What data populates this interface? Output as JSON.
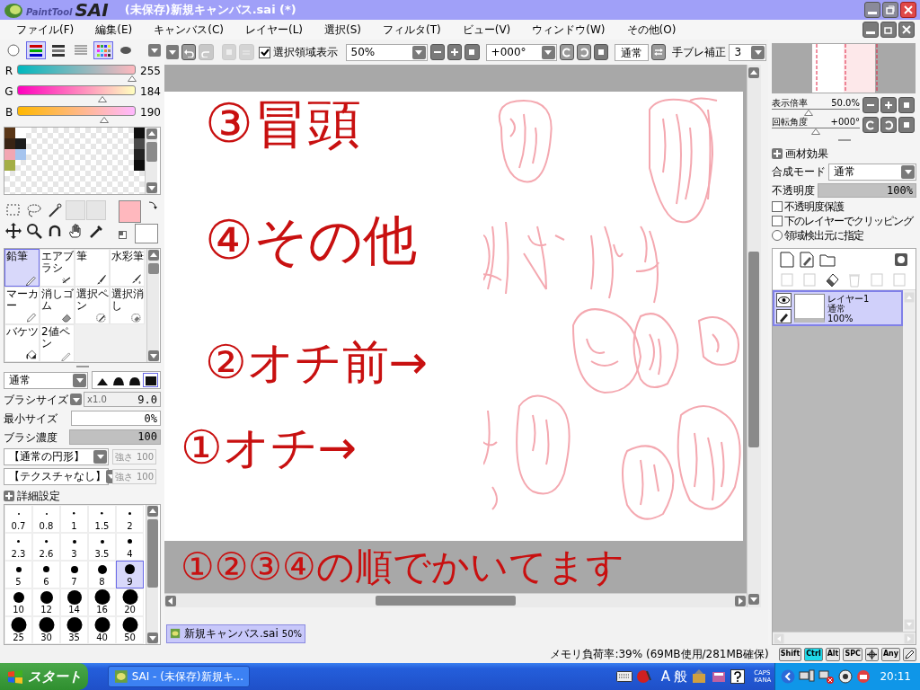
{
  "window": {
    "logo_small": "PaintTool",
    "logo_large": "SAI",
    "title": "(未保存)新規キャンバス.sai (*)"
  },
  "menu": [
    "ファイル(F)",
    "編集(E)",
    "キャンバス(C)",
    "レイヤー(L)",
    "選択(S)",
    "フィルタ(T)",
    "ビュー(V)",
    "ウィンドウ(W)",
    "その他(O)"
  ],
  "color_modes": [
    {
      "kind": "wheel",
      "selected": false
    },
    {
      "kind": "rgb",
      "selected": true
    },
    {
      "kind": "hsv",
      "selected": false
    },
    {
      "kind": "mixer",
      "selected": false
    },
    {
      "kind": "swatches",
      "selected": true
    },
    {
      "kind": "scratchpad",
      "selected": false
    }
  ],
  "sliders": [
    {
      "label": "R",
      "value": "255",
      "level": 0.98
    },
    {
      "label": "G",
      "value": "184",
      "level": 0.72
    },
    {
      "label": "B",
      "value": "190",
      "level": 0.74
    }
  ],
  "swatches_left": [
    {
      "color": "#5a3617"
    },
    {
      "color": "#ffffff"
    },
    {
      "color": "#3a2414"
    },
    {
      "color": "#1c1c1c"
    },
    {
      "color": "#f2a6b2"
    },
    {
      "color": "#a6c4ee"
    },
    {
      "color": "#a4ae46"
    }
  ],
  "swatches_right": [
    {
      "color": "#111111"
    },
    {
      "color": "#4a4a4a"
    },
    {
      "color": "#222222"
    },
    {
      "color": "#0c0c0c"
    }
  ],
  "color_box": {
    "main": {
      "color": "#ffb8be"
    },
    "sub": {
      "color": "#ffffff"
    }
  },
  "tools": [
    {
      "kind": "pencil",
      "label": "鉛筆",
      "selected": true
    },
    {
      "kind": "airbrush",
      "label": "エアブラシ",
      "selected": false
    },
    {
      "kind": "brush",
      "label": "筆",
      "selected": false
    },
    {
      "kind": "watercolor",
      "label": "水彩筆",
      "selected": false
    },
    {
      "kind": "marker",
      "label": "マーカー",
      "selected": false
    },
    {
      "kind": "eraser",
      "label": "消しゴム",
      "selected": false
    },
    {
      "kind": "select-pen",
      "label": "選択ペン",
      "selected": false
    },
    {
      "kind": "select-eraser",
      "label": "選択消し",
      "selected": false
    },
    {
      "kind": "bucket",
      "label": "バケツ",
      "selected": false
    },
    {
      "kind": "binary-pen",
      "label": "2値ペン",
      "selected": false
    }
  ],
  "brush": {
    "blend_mode": "通常",
    "edge_shapes": [
      {
        "selected": false
      },
      {
        "selected": false
      },
      {
        "selected": false
      },
      {
        "selected": true
      }
    ],
    "size": {
      "label": "ブラシサイズ",
      "multiplier": "x1.0",
      "value": "9.0"
    },
    "min_size": {
      "label": "最小サイズ",
      "value": "0%"
    },
    "density": {
      "label": "ブラシ濃度",
      "value": "100",
      "level": 1
    },
    "shape": {
      "value": "【通常の円形】",
      "strength_label": "強さ",
      "strength": "100",
      "disabled": true
    },
    "texture": {
      "value": "【テクスチャなし】",
      "strength_label": "強さ",
      "strength": "100",
      "disabled": true
    },
    "advanced": "詳細設定"
  },
  "brush_sizes": [
    {
      "label": "0.7",
      "selected": false
    },
    {
      "label": "0.8",
      "selected": false
    },
    {
      "label": "1",
      "selected": false
    },
    {
      "label": "1.5",
      "selected": false
    },
    {
      "label": "2",
      "selected": false
    },
    {
      "label": "2.3",
      "selected": false
    },
    {
      "label": "2.6",
      "selected": false
    },
    {
      "label": "3",
      "selected": false
    },
    {
      "label": "3.5",
      "selected": false
    },
    {
      "label": "4",
      "selected": false
    },
    {
      "label": "5",
      "selected": false
    },
    {
      "label": "6",
      "selected": false
    },
    {
      "label": "7",
      "selected": false
    },
    {
      "label": "8",
      "selected": false
    },
    {
      "label": "9",
      "selected": true
    },
    {
      "label": "10",
      "selected": false
    },
    {
      "label": "12",
      "selected": false
    },
    {
      "label": "14",
      "selected": false
    },
    {
      "label": "16",
      "selected": false
    },
    {
      "label": "20",
      "selected": false
    },
    {
      "label": "25",
      "selected": false
    },
    {
      "label": "30",
      "selected": false
    },
    {
      "label": "35",
      "selected": false
    },
    {
      "label": "40",
      "selected": false
    },
    {
      "label": "50",
      "selected": false
    }
  ],
  "toolbar": {
    "show_selection": {
      "label": "選択領域表示",
      "checked": true
    },
    "zoom": "50%",
    "angle": "+000°",
    "blend": "通常",
    "stabilizer": {
      "label": "手ブレ補正",
      "value": "3"
    }
  },
  "canvas": {
    "notes": [
      "③冒頭",
      "④その他",
      "②オチ前→",
      "①オチ→"
    ],
    "footer_note": "①②③④の順でかいてます"
  },
  "canvas_tab": {
    "name": "新規キャンバス.sai",
    "zoom": "50%"
  },
  "navigator": {
    "zoom": {
      "label": "表示倍率",
      "value": "50.0%",
      "level": 0.42
    },
    "rotation": {
      "label": "回転角度",
      "value": "+000°",
      "level": 0.5
    }
  },
  "layer_props": {
    "title": "画材効果",
    "blend": {
      "label": "合成モード",
      "value": "通常"
    },
    "opacity": {
      "label": "不透明度",
      "value": "100%",
      "level": 1
    },
    "options": [
      {
        "kind": "checkbox",
        "label": "不透明度保護",
        "checked": false
      },
      {
        "kind": "checkbox",
        "label": "下のレイヤーでクリッピング",
        "checked": false
      },
      {
        "kind": "radio",
        "label": "領域検出元に指定",
        "checked": false
      }
    ]
  },
  "layers": [
    {
      "name": "レイヤー1",
      "mode": "通常",
      "opacity": "100%",
      "selected": true,
      "visible": true
    }
  ],
  "status": {
    "memory": "メモリ負荷率:39% (69MB使用/281MB確保)",
    "keys": [
      {
        "kind": "text",
        "label": "Shift",
        "on": false
      },
      {
        "kind": "text",
        "label": "Ctrl",
        "on": true
      },
      {
        "kind": "text",
        "label": "Alt",
        "on": false
      },
      {
        "kind": "text",
        "label": "SPC",
        "on": false
      },
      {
        "kind": "move",
        "on": false
      },
      {
        "kind": "text",
        "label": "Any",
        "on": false
      },
      {
        "kind": "pen",
        "on": false
      }
    ]
  },
  "taskbar": {
    "start": "スタート",
    "tasks": [
      "SAI - (未保存)新規キ..."
    ],
    "ime_mode": "A",
    "ime_kanji": "般",
    "caps": "CAPS",
    "kana": "KANA",
    "clock": "20:11"
  }
}
